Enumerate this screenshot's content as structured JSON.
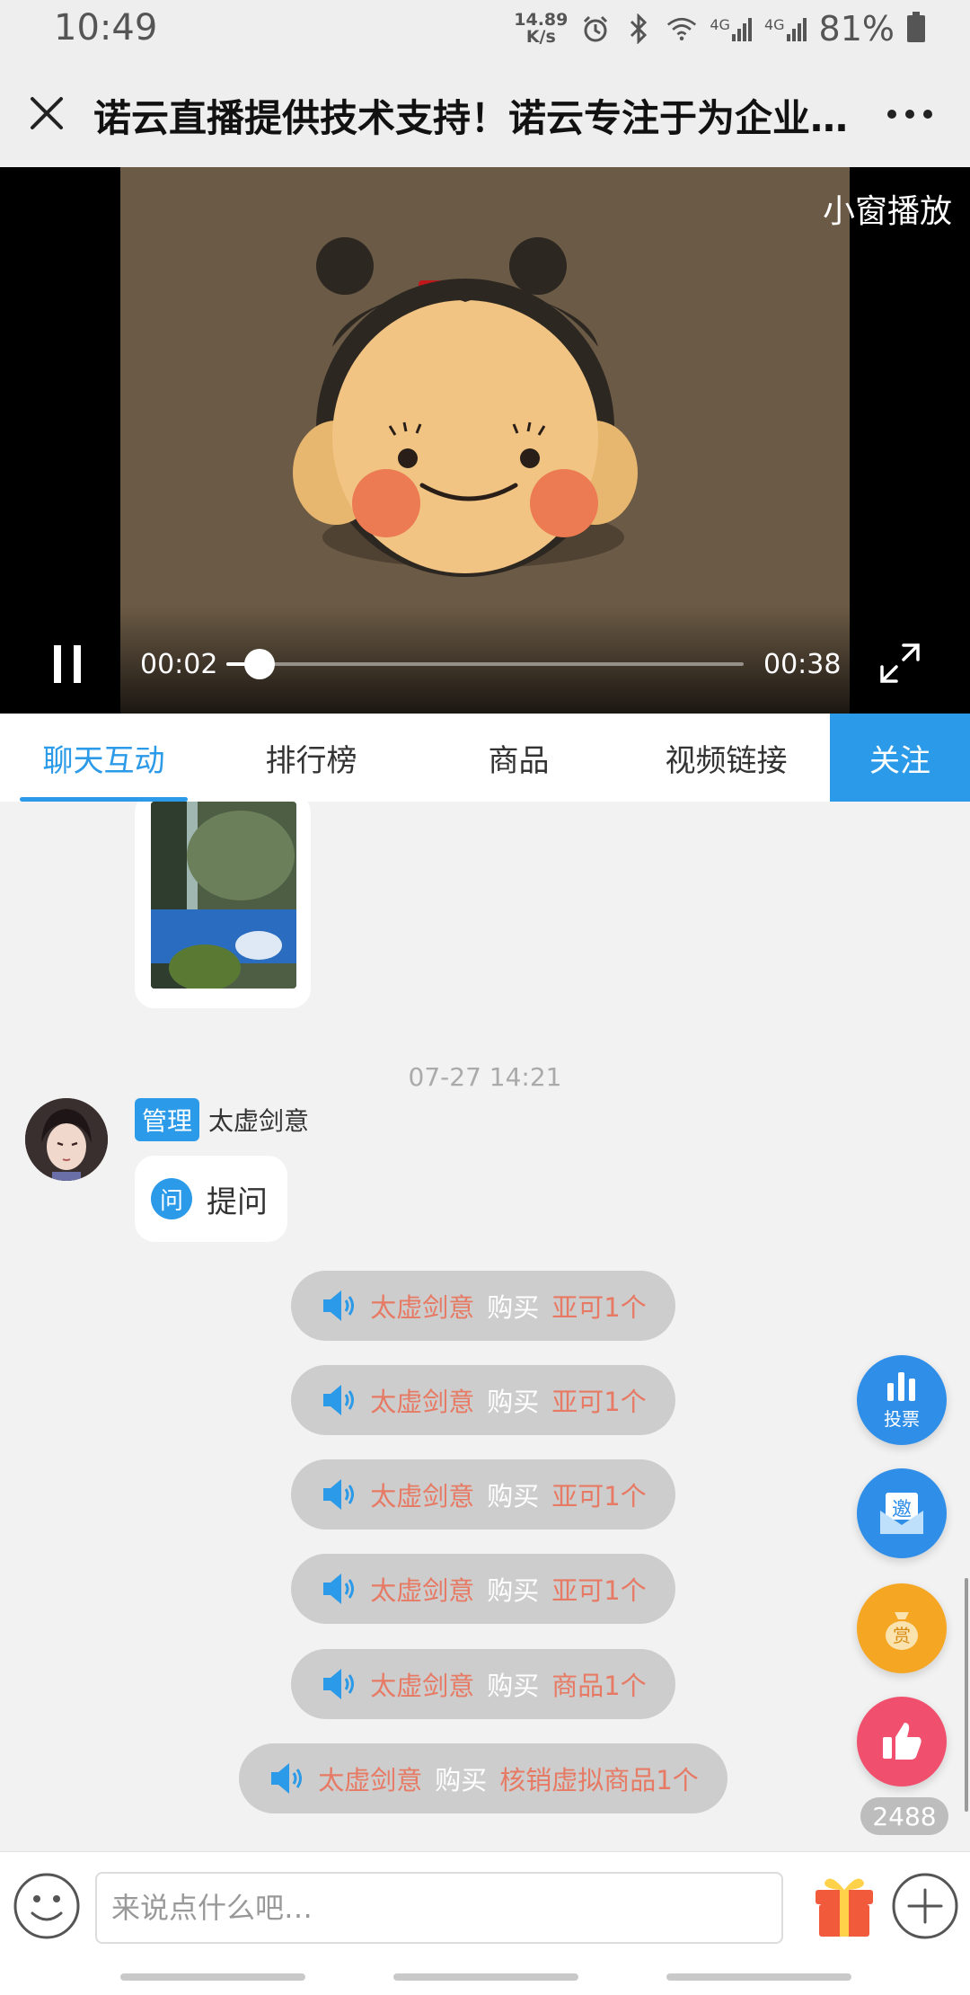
{
  "status_bar": {
    "time": "10:49",
    "net_speed_value": "14.89",
    "net_speed_unit": "K/s",
    "signal_1": "4G",
    "signal_2": "4G",
    "battery": "81%"
  },
  "header": {
    "title": "诺云直播提供技术支持！诺云专注于为企业提供…"
  },
  "video": {
    "mini_window_label": "小窗播放",
    "current_time": "00:02",
    "total_time": "00:38",
    "progress": 0.064
  },
  "tabs": {
    "items": [
      {
        "label": "聊天互动",
        "active": true
      },
      {
        "label": "排行榜",
        "active": false
      },
      {
        "label": "商品",
        "active": false
      },
      {
        "label": "视频链接",
        "active": false
      }
    ],
    "follow_label": "关注"
  },
  "chat": {
    "timestamp": "07-27 14:21",
    "message": {
      "badge": "管理",
      "sender": "太虚剑意",
      "question_icon": "问",
      "question_text": "提问"
    },
    "notices": [
      {
        "name": "太虚剑意",
        "action": "购买",
        "item": "亚可1个"
      },
      {
        "name": "太虚剑意",
        "action": "购买",
        "item": "亚可1个"
      },
      {
        "name": "太虚剑意",
        "action": "购买",
        "item": "亚可1个"
      },
      {
        "name": "太虚剑意",
        "action": "购买",
        "item": "亚可1个"
      },
      {
        "name": "太虚剑意",
        "action": "购买",
        "item": "商品1个"
      },
      {
        "name": "太虚剑意",
        "action": "购买",
        "item": "核销虚拟商品1个"
      }
    ]
  },
  "floating": {
    "vote_label": "投票",
    "invite_label": "邀",
    "reward_label": "赏",
    "like_count": "2488"
  },
  "input": {
    "placeholder": "来说点什么吧…"
  },
  "colors": {
    "accent": "#2b9ae8",
    "notice_highlight": "#e77a64",
    "reward": "#f5a623",
    "like": "#f0506e"
  }
}
